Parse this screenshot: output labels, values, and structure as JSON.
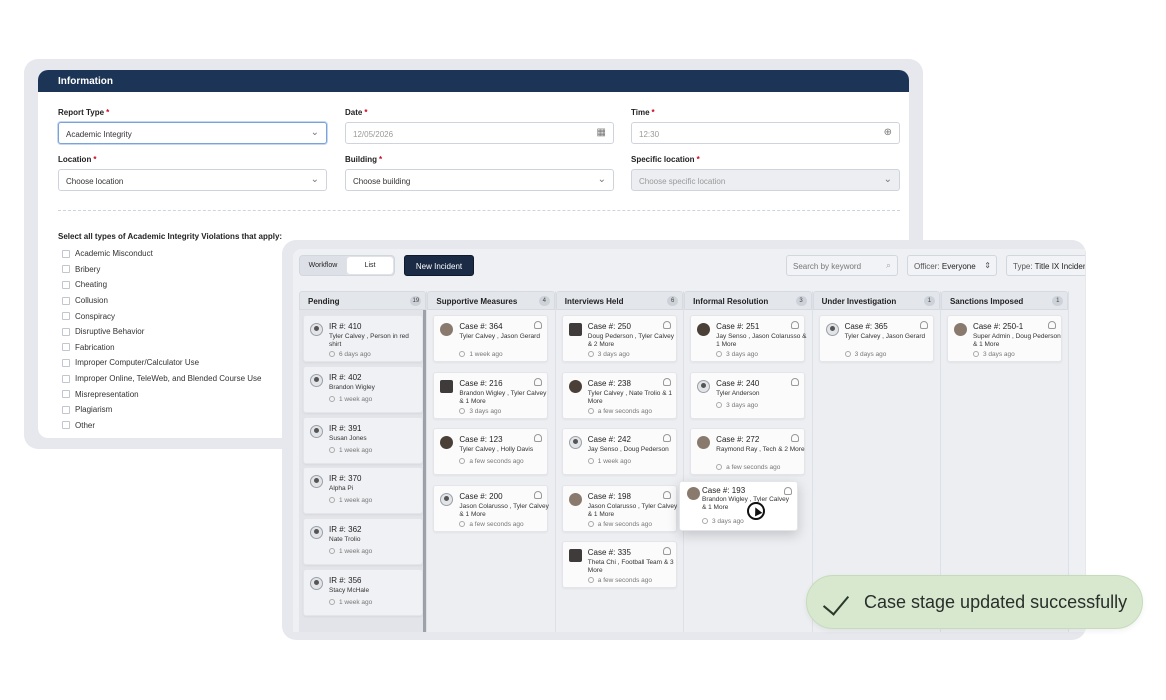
{
  "info": {
    "header": "Information",
    "report_type": {
      "label": "Report Type",
      "value": "Academic Integrity"
    },
    "date": {
      "label": "Date",
      "value": "12/05/2026"
    },
    "time": {
      "label": "Time",
      "value": "12:30"
    },
    "location": {
      "label": "Location",
      "value": "Choose location"
    },
    "building": {
      "label": "Building",
      "value": "Choose building"
    },
    "specific_location": {
      "label": "Specific location",
      "value": "Choose specific location"
    },
    "violations_title": "Select all types of Academic Integrity Violations that apply:",
    "violations": [
      "Academic Misconduct",
      "Bribery",
      "Cheating",
      "Collusion",
      "Conspiracy",
      "Disruptive Behavior",
      "Fabrication",
      "Improper Computer/Calculator Use",
      "Improper Online, TeleWeb, and Blended Course Use",
      "Misrepresentation",
      "Plagiarism",
      "Other"
    ]
  },
  "toolbar": {
    "workflow": "Workflow",
    "list": "List",
    "new_incident": "New Incident",
    "search_placeholder": "Search by keyword",
    "officer_label": "Officer:",
    "officer_value": "Everyone",
    "type_label": "Type:",
    "type_value": "Title IX Incident"
  },
  "columns": [
    {
      "title": "Pending",
      "count": "19",
      "cards": [
        {
          "title": "IR #: 410",
          "names": "Tyler Calvey , Person in red shirt",
          "time": "6 days ago"
        },
        {
          "title": "IR #: 402",
          "names": "Brandon Wigley",
          "time": "1 week ago"
        },
        {
          "title": "IR #: 391",
          "names": "Susan Jones",
          "time": "1 week ago"
        },
        {
          "title": "IR #: 370",
          "names": "Alpha Pi",
          "time": "1 week ago"
        },
        {
          "title": "IR #: 362",
          "names": "Nate Trolio",
          "time": "1 week ago"
        },
        {
          "title": "IR #: 356",
          "names": "Stacy McHale",
          "time": "1 week ago"
        }
      ]
    },
    {
      "title": "Supportive Measures",
      "count": "4",
      "cards": [
        {
          "title": "Case #: 364",
          "names": "Tyler Calvey , Jason Gerard",
          "time": "1 week ago"
        },
        {
          "title": "Case #: 216",
          "names": "Brandon Wigley , Tyler Calvey & 1 More",
          "time": "3 days ago"
        },
        {
          "title": "Case #: 123",
          "names": "Tyler Calvey , Holly Davis",
          "time": "a few seconds ago"
        },
        {
          "title": "Case #: 200",
          "names": "Jason Colarusso , Tyler Calvey & 1 More",
          "time": "a few seconds ago"
        }
      ]
    },
    {
      "title": "Interviews Held",
      "count": "6",
      "cards": [
        {
          "title": "Case #: 250",
          "names": "Doug Pederson , Tyler Calvey & 2 More",
          "time": "3 days ago"
        },
        {
          "title": "Case #: 238",
          "names": "Tyler Calvey , Nate Trolio & 1 More",
          "time": "a few seconds ago"
        },
        {
          "title": "Case #: 242",
          "names": "Jay Senso , Doug Pederson",
          "time": "1 week ago"
        },
        {
          "title": "Case #: 198",
          "names": "Jason Colarusso , Tyler Calvey & 1 More",
          "time": "a few seconds ago"
        },
        {
          "title": "Case #: 335",
          "names": "Theta Chi , Football Team & 3 More",
          "time": "a few seconds ago"
        }
      ]
    },
    {
      "title": "Informal Resolution",
      "count": "3",
      "cards": [
        {
          "title": "Case #: 251",
          "names": "Jay Senso , Jason Colarusso & 1 More",
          "time": "3 days ago"
        },
        {
          "title": "Case #: 240",
          "names": "Tyler Anderson",
          "time": "3 days ago"
        },
        {
          "title": "Case #: 272",
          "names": "Raymond Ray , Tech & 2 More",
          "time": "a few seconds ago"
        }
      ]
    },
    {
      "title": "Under Investigation",
      "count": "1",
      "cards": [
        {
          "title": "Case #: 365",
          "names": "Tyler Calvey , Jason Gerard",
          "time": "3 days ago"
        }
      ]
    },
    {
      "title": "Sanctions Imposed",
      "count": "1",
      "cards": [
        {
          "title": "Case #: 250-1",
          "names": "Super Admin , Doug Pederson & 1 More",
          "time": "3 days ago"
        }
      ]
    }
  ],
  "dragging_card": {
    "title": "Case #: 193",
    "names": "Brandon Wigley , Tyler Calvey & 1 More",
    "time": "3 days ago"
  },
  "toast": {
    "message": "Case stage updated successfully"
  }
}
